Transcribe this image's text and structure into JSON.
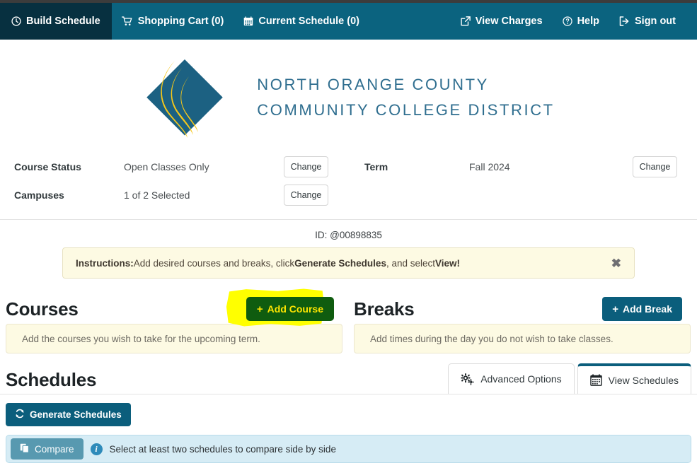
{
  "nav": {
    "left_items": [
      {
        "label": "Build Schedule",
        "icon": "clock-icon",
        "active": true
      },
      {
        "label": "Shopping Cart (0)",
        "icon": "cart-icon",
        "active": false
      },
      {
        "label": "Current Schedule (0)",
        "icon": "calendar-icon",
        "active": false
      }
    ],
    "right_items": [
      {
        "label": "View Charges",
        "icon": "external-link-icon"
      },
      {
        "label": "Help",
        "icon": "question-circle-icon"
      },
      {
        "label": "Sign out",
        "icon": "sign-out-icon"
      }
    ]
  },
  "brand": {
    "line1": "North Orange County",
    "line2": "Community College District",
    "logo_icon": "noccd-diamond-logo",
    "diamond_color": "#1c6182",
    "swoosh_color": "#f5c71a",
    "text_color": "#2f6e8f"
  },
  "settings": {
    "course_status_label": "Course Status",
    "course_status_value": "Open Classes Only",
    "course_status_change": "Change",
    "term_label": "Term",
    "term_value": "Fall 2024",
    "term_change": "Change",
    "campuses_label": "Campuses",
    "campuses_value": "1 of 2 Selected",
    "campuses_change": "Change"
  },
  "student": {
    "id_line": "ID: @00898835"
  },
  "instructions": {
    "prefix": "Instructions:",
    "text_part1": " Add desired courses and breaks, click ",
    "emphasis1": "Generate Schedules",
    "text_part2": " , and select ",
    "emphasis2": "View!",
    "close_icon": "close-icon"
  },
  "courses": {
    "title": "Courses",
    "add_button": "+ Add Course",
    "add_button_plus": "+",
    "add_button_text": "Add Course",
    "empty_text": "Add the courses you wish to take for the upcoming term.",
    "button_bg": "#0f5c0f",
    "button_text_color": "#ffe600",
    "highlight_color": "#ffff00"
  },
  "breaks": {
    "title": "Breaks",
    "add_button_plus": "+",
    "add_button_text": "Add Break",
    "empty_text": "Add times during the day you do not wish to take classes.",
    "button_bg": "#0b5e7c"
  },
  "schedules": {
    "title": "Schedules",
    "tabs": [
      {
        "label": "Advanced Options",
        "icon": "gears-icon",
        "active": false
      },
      {
        "label": "View Schedules",
        "icon": "calendar-icon",
        "active": true
      }
    ],
    "generate_button": "Generate Schedules",
    "generate_icon": "refresh-icon"
  },
  "compare": {
    "button_label": "Compare",
    "button_icon": "copy-stack-icon",
    "info_icon": "info-circle-icon",
    "info_glyph": "i",
    "message": "Select at least two schedules to compare side by side",
    "bar_bg": "#d6ecf5",
    "button_bg": "#4e93ab"
  }
}
